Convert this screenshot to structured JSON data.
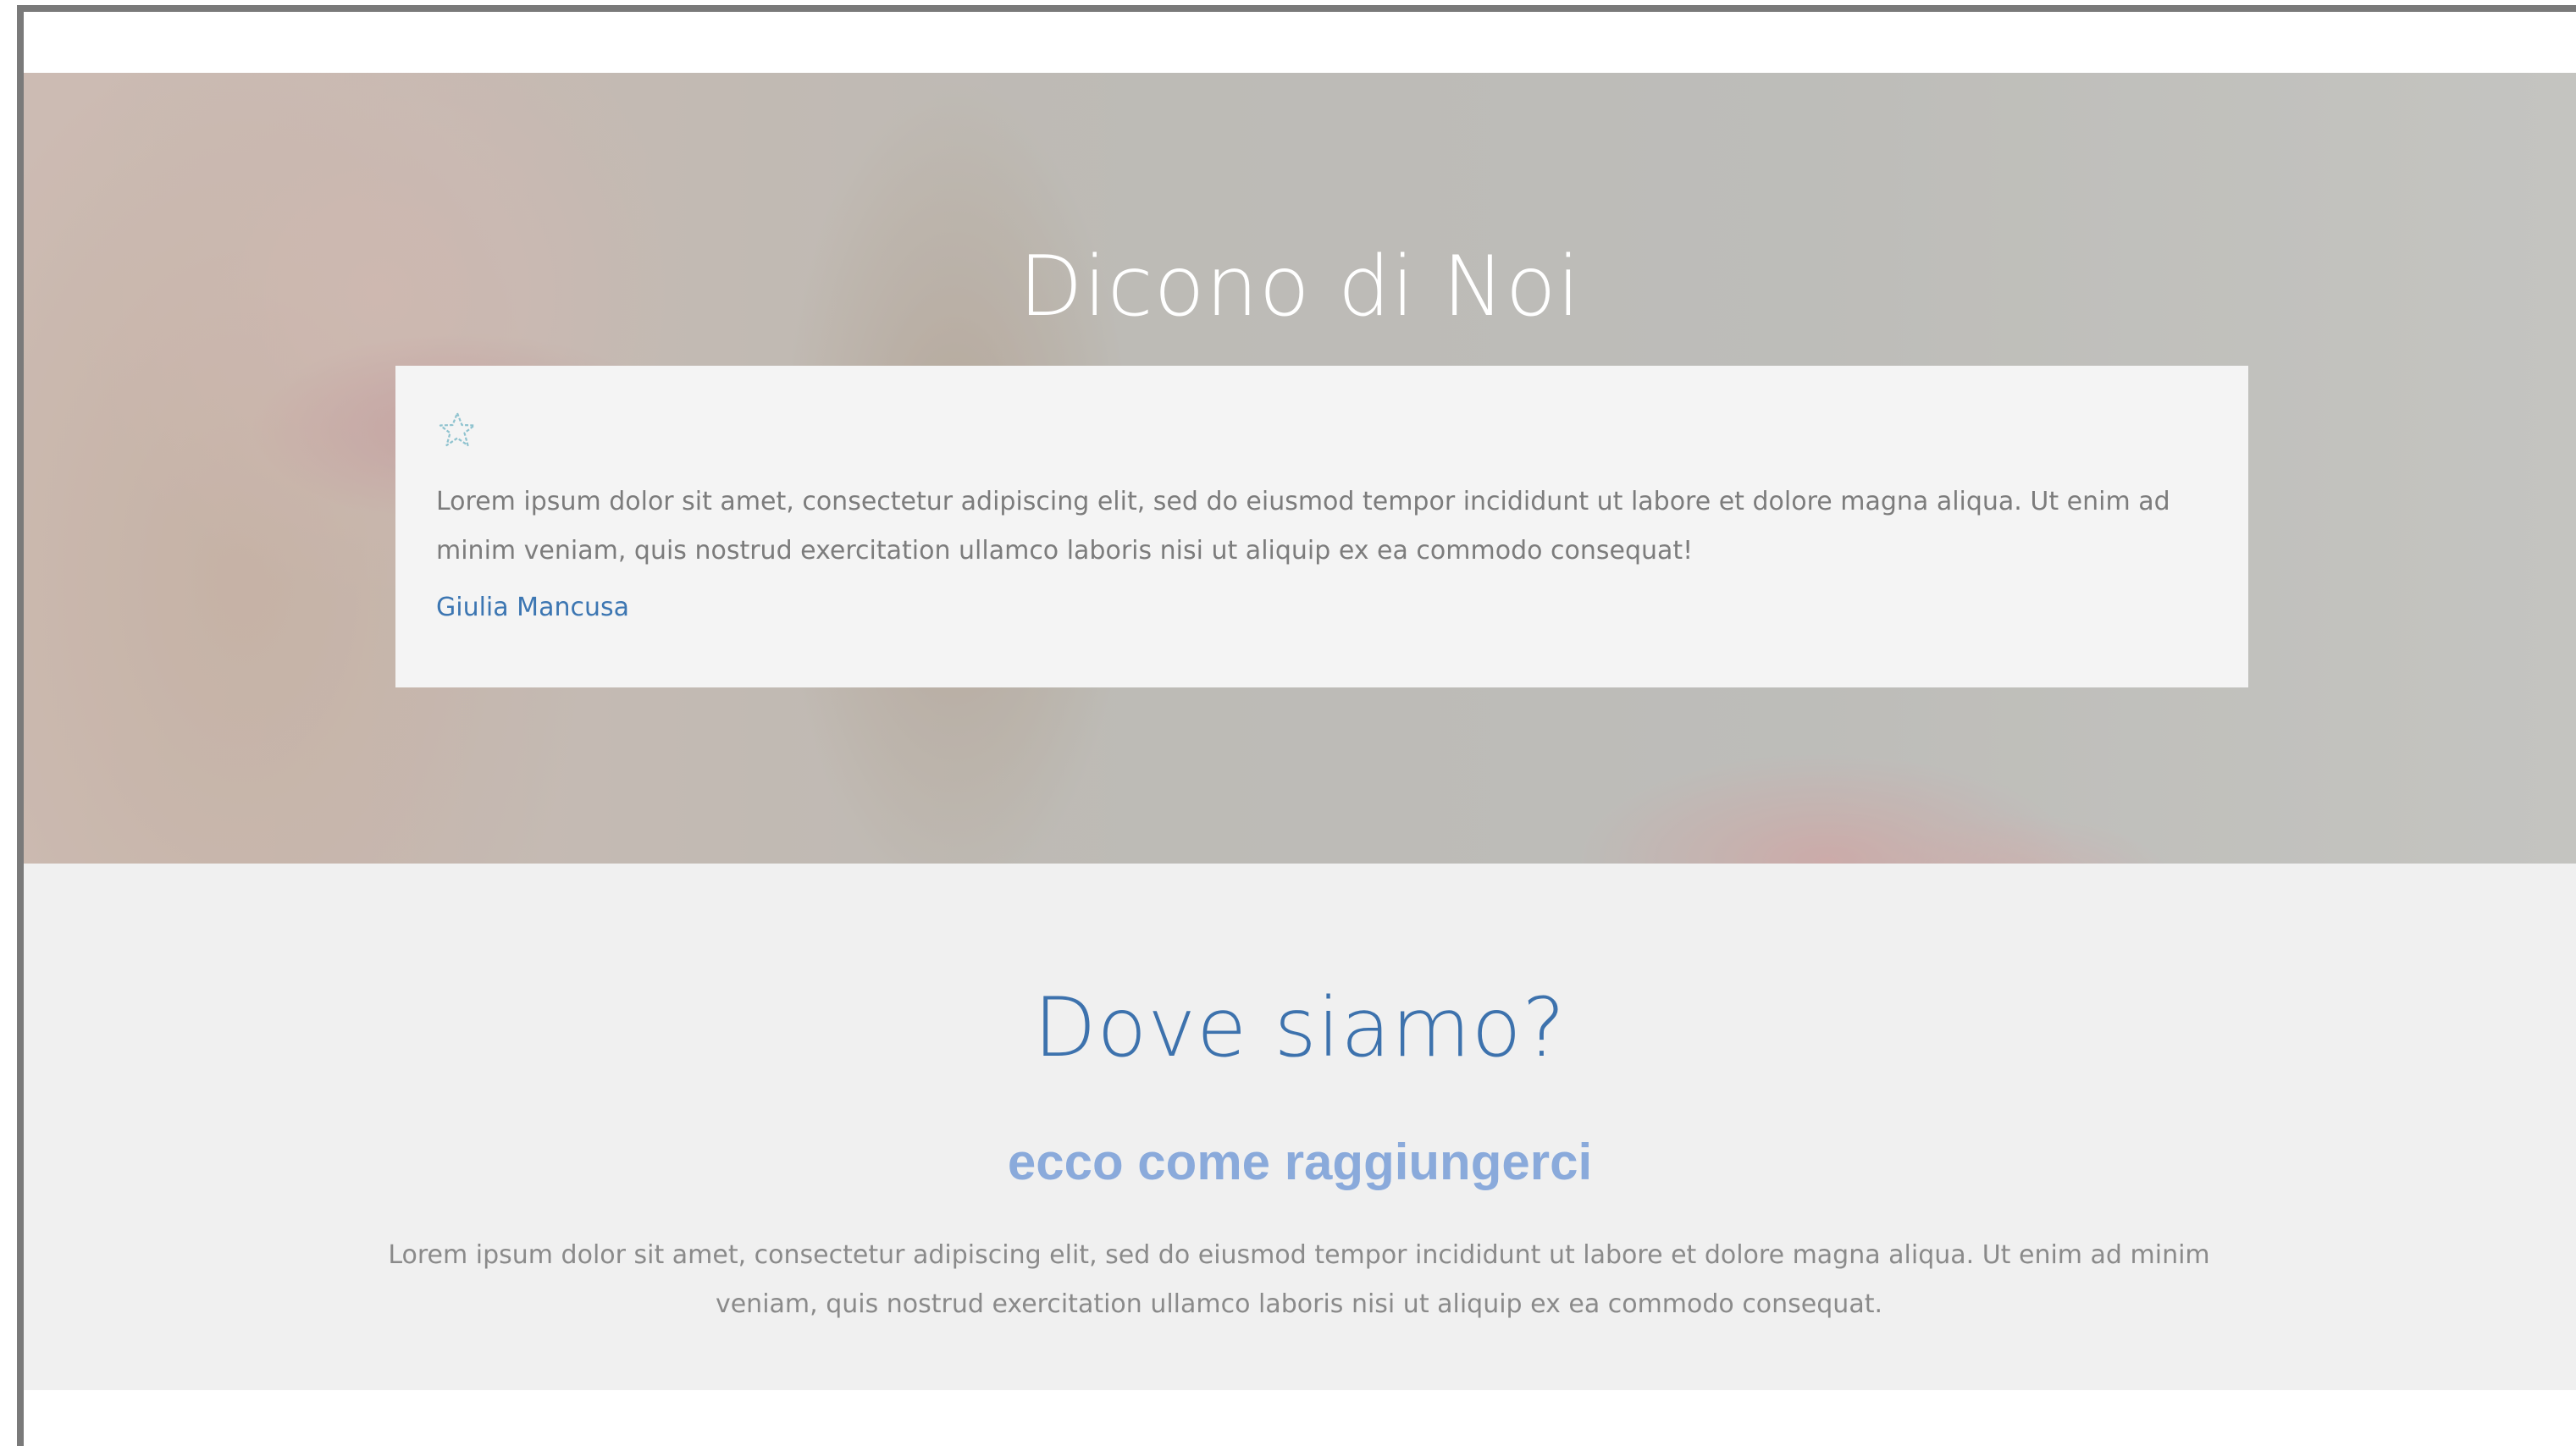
{
  "testimonials": {
    "title": "Dicono di Noi",
    "quote_icon": "star-icon",
    "items": [
      {
        "text": "Lorem ipsum dolor sit amet, consectetur adipiscing elit, sed do eiusmod tempor incididunt ut labore et dolore magna aliqua. Ut enim ad minim veniam, quis nostrud exercitation ullamco laboris nisi ut aliquip ex ea commodo consequat!",
        "author": "Giulia Mancusa"
      }
    ]
  },
  "location": {
    "title": "Dove siamo?",
    "subtitle": "ecco come raggiungerci",
    "text": "Lorem ipsum dolor sit amet, consectetur adipiscing elit, sed do eiusmod tempor incididunt ut labore et dolore magna aliqua. Ut enim ad minim veniam, quis nostrud exercitation ullamco laboris nisi ut aliquip ex ea commodo consequat."
  },
  "colors": {
    "accent_blue": "#3d72ad",
    "subtitle_blue": "#8aaadb",
    "star_icon": "#8fc3cf",
    "body_text": "#7c7c7c"
  }
}
